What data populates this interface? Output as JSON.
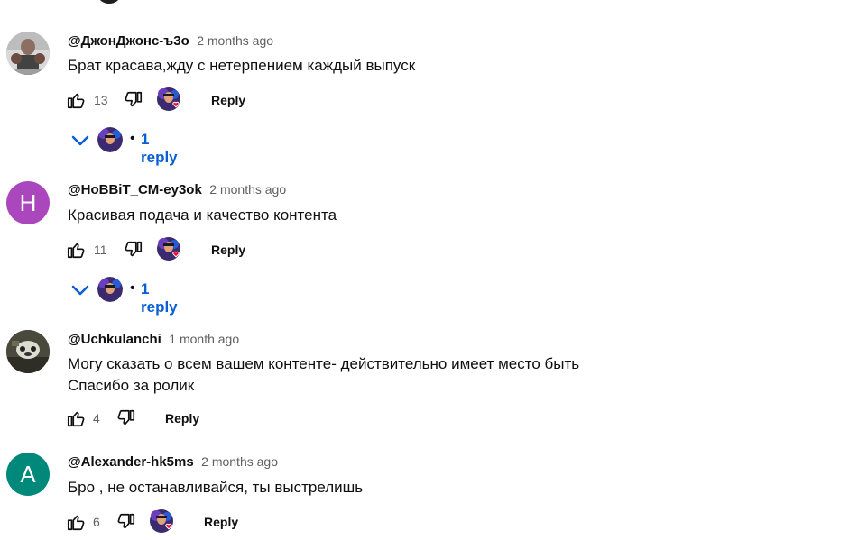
{
  "colors": {
    "author_text": "#0f0f0f",
    "time_text": "#606060",
    "reply_link": "#065fd4",
    "heart": "#ff0033",
    "avatar_h_bg": "#ab47bc",
    "avatar_a_bg": "#00897b"
  },
  "comments": [
    {
      "author": "@ДжонДжонс-ъ3о",
      "time": "2 months ago",
      "text_lines": [
        "Брат красава,жду с нетерпением каждый выпуск"
      ],
      "likes": "13",
      "hearted": true,
      "reply_label": "Reply",
      "avatar_icon": "user-photo-fighter",
      "replies_label": "1 reply"
    },
    {
      "author": "@HoBBiT_CM-ey3ok",
      "time": "2 months ago",
      "text_lines": [
        "Красивая подача и качество контента"
      ],
      "likes": "11",
      "hearted": true,
      "reply_label": "Reply",
      "avatar_letter": "H",
      "replies_label": "1 reply"
    },
    {
      "author": "@Uchkulanchi",
      "time": "1 month ago",
      "text_lines": [
        "Могу сказать о всем вашем контенте- действительно имеет место быть",
        "Спасибо за ролик"
      ],
      "likes": "4",
      "hearted": false,
      "reply_label": "Reply",
      "avatar_icon": "user-photo-animal"
    },
    {
      "author": "@Alexander-hk5ms",
      "time": "2 months ago",
      "text_lines": [
        "Бро , не останавливайся, ты выстрелишь"
      ],
      "likes": "6",
      "hearted": true,
      "reply_label": "Reply",
      "avatar_letter": "A"
    }
  ],
  "icons": {
    "like": "thumbs-up-icon",
    "dislike": "thumbs-down-icon",
    "heart": "creator-heart-icon",
    "expand": "chevron-down-icon",
    "bullet": "•"
  }
}
